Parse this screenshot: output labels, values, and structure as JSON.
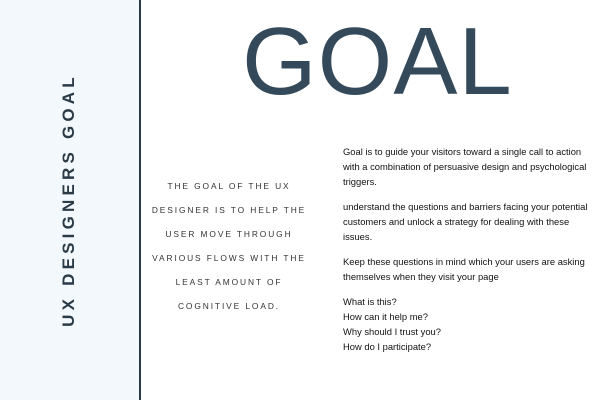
{
  "sidebar": {
    "vertical_title": "UX DESIGNERS GOAL"
  },
  "main": {
    "title": "GOAL",
    "subtitle": "THE GOAL OF THE UX DESIGNER IS TO HELP THE USER MOVE THROUGH VARIOUS FLOWS WITH THE LEAST AMOUNT OF COGNITIVE LOAD.",
    "paragraphs": [
      "Goal is to guide your visitors toward a single call to action with a combination of persuasive design and psychological triggers.",
      "understand the questions and barriers facing your potential customers and unlock a strategy for dealing with these issues.",
      "Keep these questions in mind which your users are asking themselves when they visit your page"
    ],
    "questions": [
      "What is this?",
      "How can it help me?",
      "Why should I trust you?",
      "How do I participate?"
    ]
  },
  "colors": {
    "dark": "#2b3a47",
    "title": "#34495a",
    "panel": "#f2f8fb"
  }
}
